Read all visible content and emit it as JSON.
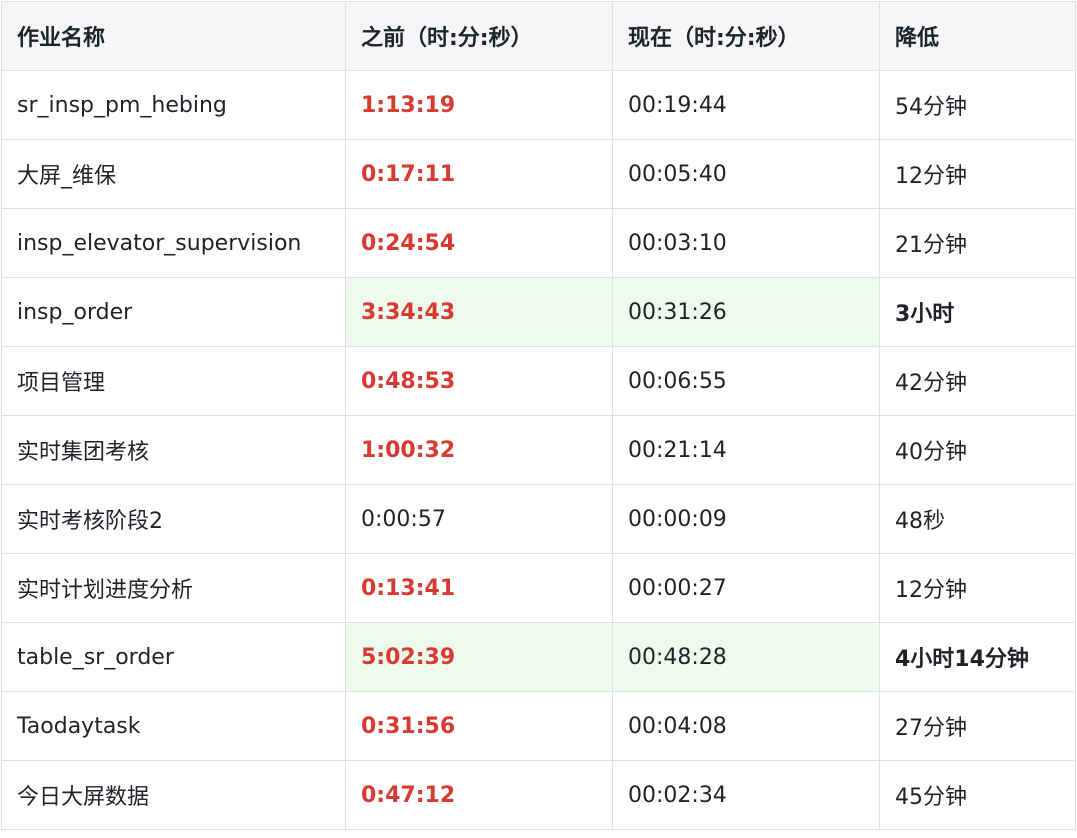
{
  "table": {
    "headers": [
      "作业名称",
      "之前（时:分:秒）",
      "现在（时:分:秒）",
      "降低"
    ],
    "rows": [
      {
        "name": "sr_insp_pm_hebing",
        "before": "1:13:19",
        "after": "00:19:44",
        "reduction": "54分钟",
        "before_red": true,
        "highlight": false,
        "reduction_bold": false
      },
      {
        "name": "大屏_维保",
        "before": "0:17:11",
        "after": "00:05:40",
        "reduction": "12分钟",
        "before_red": true,
        "highlight": false,
        "reduction_bold": false
      },
      {
        "name": "insp_elevator_supervision",
        "before": "0:24:54",
        "after": "00:03:10",
        "reduction": "21分钟",
        "before_red": true,
        "highlight": false,
        "reduction_bold": false
      },
      {
        "name": "insp_order",
        "before": "3:34:43",
        "after": "00:31:26",
        "reduction": "3小时",
        "before_red": true,
        "highlight": true,
        "reduction_bold": true
      },
      {
        "name": "项目管理",
        "before": "0:48:53",
        "after": "00:06:55",
        "reduction": "42分钟",
        "before_red": true,
        "highlight": false,
        "reduction_bold": false
      },
      {
        "name": "实时集团考核",
        "before": "1:00:32",
        "after": "00:21:14",
        "reduction": "40分钟",
        "before_red": true,
        "highlight": false,
        "reduction_bold": false
      },
      {
        "name": "实时考核阶段2",
        "before": "0:00:57",
        "after": "00:00:09",
        "reduction": "48秒",
        "before_red": false,
        "highlight": false,
        "reduction_bold": false
      },
      {
        "name": "实时计划进度分析",
        "before": "0:13:41",
        "after": "00:00:27",
        "reduction": "12分钟",
        "before_red": true,
        "highlight": false,
        "reduction_bold": false
      },
      {
        "name": "table_sr_order",
        "before": "5:02:39",
        "after": "00:48:28",
        "reduction": "4小时14分钟",
        "before_red": true,
        "highlight": true,
        "reduction_bold": true
      },
      {
        "name": "Taodaytask",
        "before": "0:31:56",
        "after": "00:04:08",
        "reduction": "27分钟",
        "before_red": true,
        "highlight": false,
        "reduction_bold": false
      },
      {
        "name": "今日大屏数据",
        "before": "0:47:12",
        "after": "00:02:34",
        "reduction": "45分钟",
        "before_red": true,
        "highlight": false,
        "reduction_bold": false
      }
    ]
  },
  "colors": {
    "red_text": "#d83931",
    "highlight_bg": "#eefaec",
    "header_bg": "#f5f6f7",
    "border": "#dee0e3"
  }
}
